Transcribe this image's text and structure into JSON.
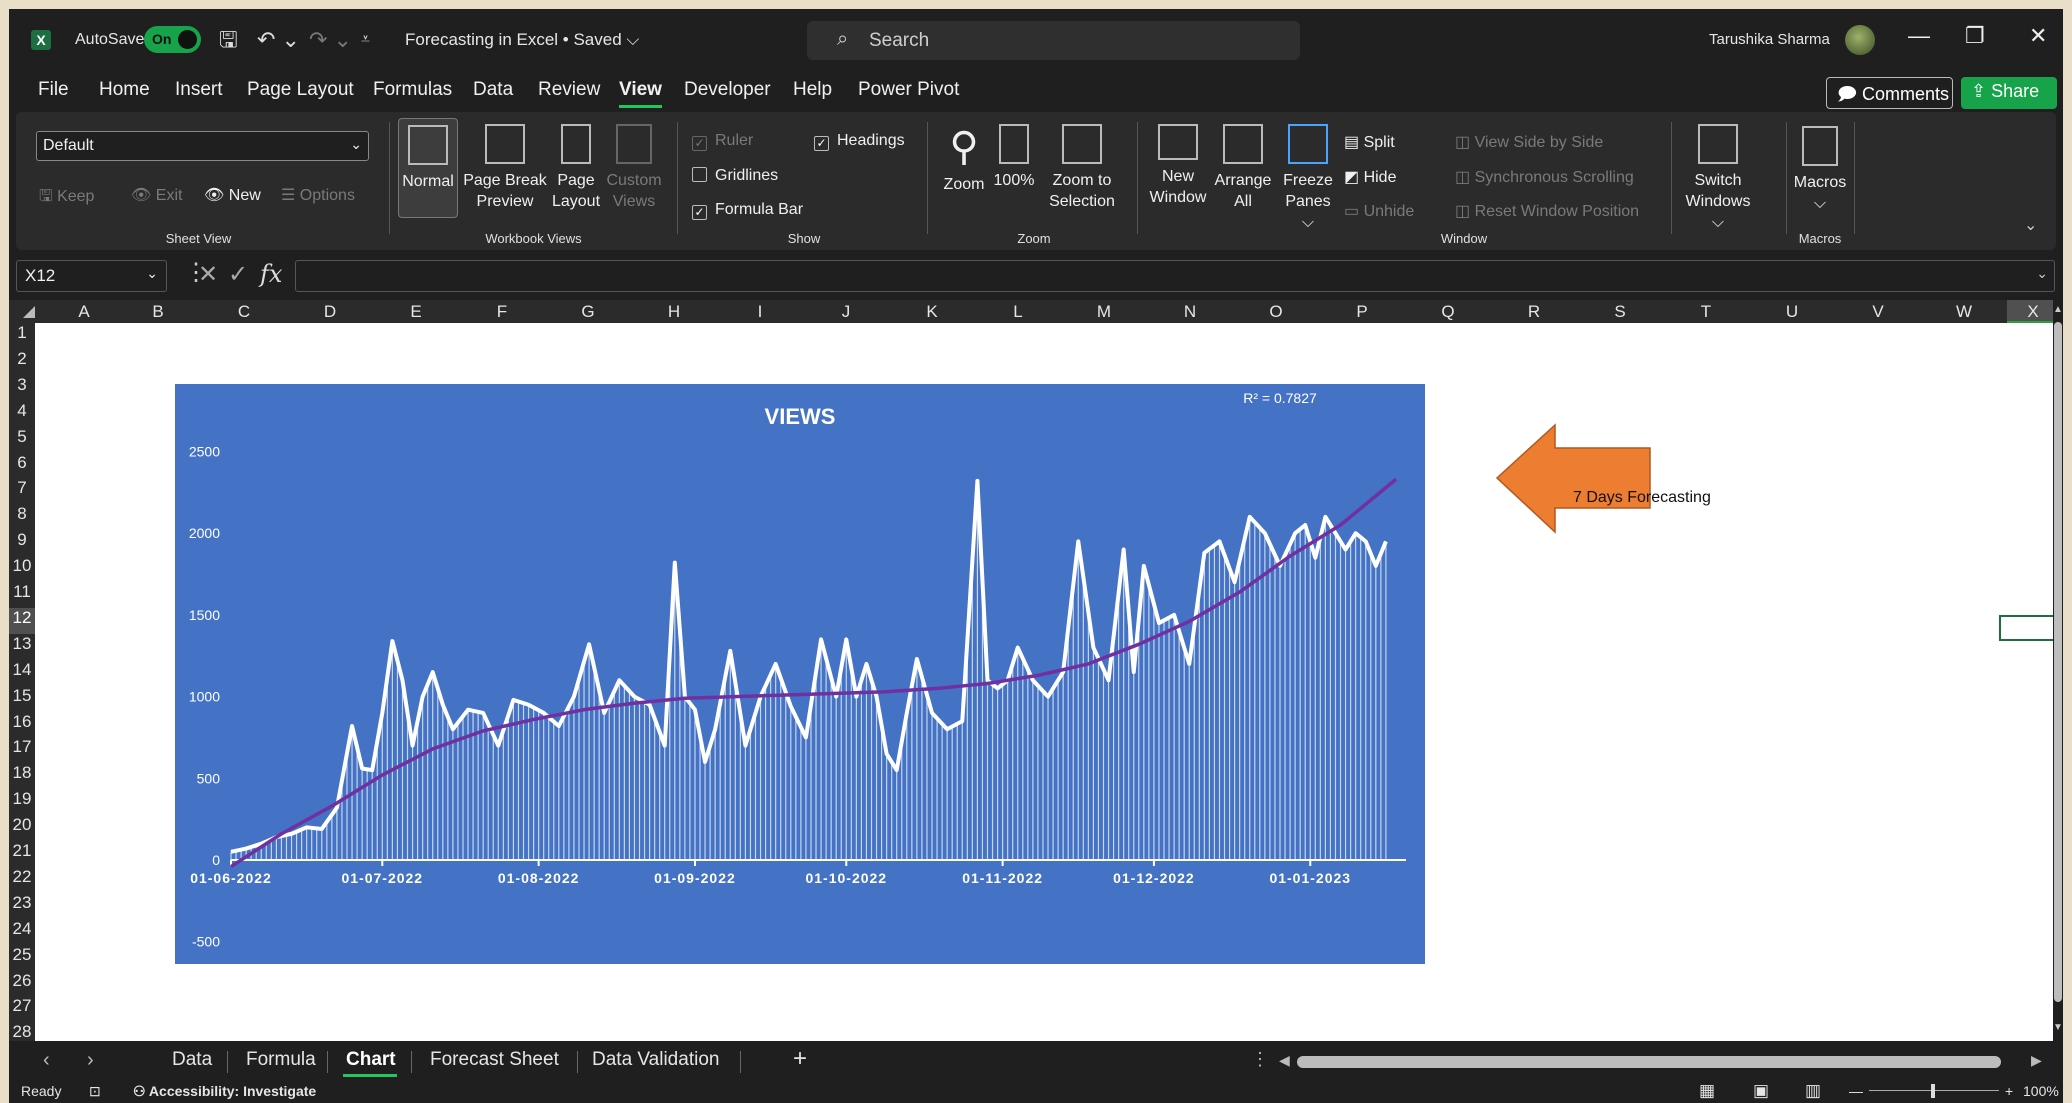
{
  "titlebar": {
    "logo_letter": "X",
    "autosave_label": "AutoSave",
    "autosave_state": "On",
    "document_title": "Forecasting in Excel • Saved ⌵",
    "search_placeholder": "Search",
    "user_name": "Tarushika Sharma"
  },
  "menu": {
    "tabs": [
      "File",
      "Home",
      "Insert",
      "Page Layout",
      "Formulas",
      "Data",
      "Review",
      "View",
      "Developer",
      "Help",
      "Power Pivot"
    ],
    "active_tab": "View",
    "comments_label": "Comments",
    "share_label": "Share"
  },
  "ribbon": {
    "sheet_view": {
      "label": "Sheet View",
      "select_value": "Default",
      "keep": "Keep",
      "exit": "Exit",
      "new": "New",
      "options": "Options"
    },
    "workbook_views": {
      "label": "Workbook Views",
      "normal": "Normal",
      "page_break_1": "Page Break",
      "page_break_2": "Preview",
      "page_layout_1": "Page",
      "page_layout_2": "Layout",
      "custom_1": "Custom",
      "custom_2": "Views"
    },
    "show": {
      "label": "Show",
      "ruler": "Ruler",
      "gridlines": "Gridlines",
      "formula_bar": "Formula Bar",
      "headings": "Headings"
    },
    "zoom": {
      "label": "Zoom",
      "zoom": "Zoom",
      "hundred": "100%",
      "zoom_sel_1": "Zoom to",
      "zoom_sel_2": "Selection"
    },
    "window": {
      "label": "Window",
      "new_window_1": "New",
      "new_window_2": "Window",
      "arrange_1": "Arrange",
      "arrange_2": "All",
      "freeze_1": "Freeze",
      "freeze_2": "Panes ⌵",
      "split": "Split",
      "hide": "Hide",
      "unhide": "Unhide",
      "side_by_side": "View Side by Side",
      "sync_scroll": "Synchronous Scrolling",
      "reset_pos": "Reset Window Position",
      "switch_1": "Switch",
      "switch_2": "Windows ⌵"
    },
    "macros": {
      "label": "Macros",
      "macros": "Macros",
      "chev": "⌵"
    }
  },
  "formula_bar": {
    "name_box": "X12",
    "fx": "fx",
    "value": ""
  },
  "grid": {
    "columns": [
      "A",
      "B",
      "C",
      "D",
      "E",
      "F",
      "G",
      "H",
      "I",
      "J",
      "K",
      "L",
      "M",
      "N",
      "O",
      "P",
      "Q",
      "R",
      "S",
      "T",
      "U",
      "V",
      "W",
      "X"
    ],
    "rows": [
      "1",
      "2",
      "3",
      "4",
      "5",
      "6",
      "7",
      "8",
      "9",
      "10",
      "11",
      "12",
      "13",
      "14",
      "15",
      "16",
      "17",
      "18",
      "19",
      "20",
      "21",
      "22",
      "23",
      "24",
      "25",
      "26",
      "27",
      "28"
    ],
    "selected_column": "X",
    "selected_row": "12"
  },
  "annotation": {
    "arrow_label": "7 Days Forecasting",
    "arrow_color": "#ed7d31"
  },
  "chart_data": {
    "type": "area",
    "title": "VIEWS",
    "r_squared_label": "R² = 0.7827",
    "background_color": "#4472c4",
    "series_color": "#ffffff",
    "trendline_color": "#7030a0",
    "ylim": [
      -500,
      2500
    ],
    "y_ticks": [
      2500,
      2000,
      1500,
      1000,
      500,
      0,
      -500
    ],
    "x_tick_labels": [
      "01-06-2022",
      "01-07-2022",
      "01-08-2022",
      "01-09-2022",
      "01-10-2022",
      "01-11-2022",
      "01-12-2022",
      "01-01-2023"
    ],
    "x_tick_days": [
      0,
      30,
      61,
      92,
      122,
      153,
      183,
      214
    ],
    "x_range_days": [
      0,
      231
    ],
    "series": [
      {
        "x": [
          0,
          3,
          6,
          9,
          12,
          15,
          18,
          21,
          24,
          26,
          28,
          30,
          32,
          34,
          36,
          38,
          40,
          42,
          44,
          47,
          50,
          53,
          56,
          59,
          62,
          65,
          68,
          71,
          74,
          77,
          80,
          83,
          86,
          88,
          90,
          92,
          94,
          96,
          99,
          102,
          105,
          108,
          111,
          114,
          117,
          120,
          122,
          124,
          126,
          128,
          130,
          132,
          134,
          136,
          139,
          142,
          145,
          148,
          150,
          152,
          154,
          156,
          159,
          162,
          165,
          168,
          171,
          174,
          177,
          179,
          181,
          184,
          187,
          190,
          193,
          196,
          199,
          202,
          205,
          208,
          211,
          213,
          215,
          217,
          219,
          221,
          223,
          225,
          227,
          229
        ],
        "values": [
          50,
          70,
          100,
          140,
          160,
          200,
          190,
          320,
          820,
          560,
          550,
          900,
          1340,
          1100,
          700,
          1000,
          1150,
          950,
          800,
          920,
          900,
          700,
          980,
          950,
          900,
          820,
          1000,
          1320,
          900,
          1100,
          1000,
          950,
          700,
          1820,
          1000,
          920,
          600,
          800,
          1280,
          700,
          1000,
          1200,
          940,
          750,
          1350,
          1000,
          1350,
          1000,
          1200,
          1000,
          650,
          550,
          900,
          1230,
          900,
          800,
          850,
          2320,
          1100,
          1050,
          1100,
          1300,
          1100,
          1000,
          1150,
          1950,
          1300,
          1100,
          1900,
          1150,
          1800,
          1450,
          1500,
          1200,
          1880,
          1950,
          1700,
          2100,
          2000,
          1800,
          2000,
          2050,
          1850,
          2100,
          2000,
          1900,
          2000,
          1950,
          1800,
          1950
        ]
      }
    ],
    "trendline": {
      "x": [
        0,
        10,
        20,
        30,
        40,
        50,
        60,
        70,
        80,
        90,
        100,
        110,
        120,
        130,
        140,
        150,
        160,
        170,
        180,
        190,
        200,
        210,
        220,
        231
      ],
      "values": [
        -40,
        160,
        330,
        520,
        680,
        790,
        860,
        920,
        960,
        990,
        1000,
        1010,
        1020,
        1030,
        1050,
        1080,
        1130,
        1200,
        1320,
        1460,
        1640,
        1860,
        2050,
        2330
      ]
    }
  },
  "sheet_tabs": {
    "tabs": [
      "Data",
      "Formula",
      "Chart",
      "Forecast Sheet",
      "Data Validation"
    ],
    "active": "Chart",
    "add": "+"
  },
  "status": {
    "ready": "Ready",
    "accessibility": "Accessibility: Investigate",
    "zoom": "100%"
  }
}
